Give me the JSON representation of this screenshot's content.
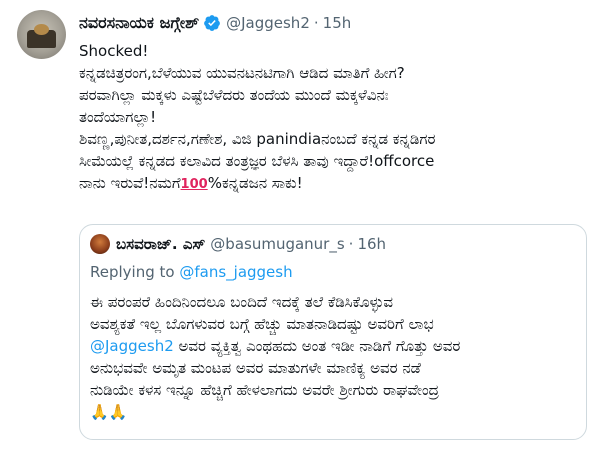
{
  "tweet": {
    "author_name": "ನವರಸನಾಯಕ ಜಗ್ಗೇಶ್",
    "handle": "@Jaggesh2",
    "separator": "·",
    "time": "15h",
    "lines": [
      "Shocked!",
      "ಕನ್ನಡಚಿತ್ರರಂಗ,ಬೆಳೆಯುವ ಯುವನಟನಟಿಗಾಗಿ ಆಡಿದ ಮಾತಿಗೆ ಹೀಗ?",
      "ಪರವಾಗಿಲ್ಲಾ ಮಕ್ಕಳು ಎಷ್ಟೆಬೆಳೆದರು ತಂದೆಯ ಮುಂದೆ ಮಕ್ಕಳೆವಿನಃ",
      "ತಂದೆಯಾಗಲ್ಲಾ!",
      "ಶಿವಣ್ಣ,ಪುನೀತ,ದರ್ಶನ,ಗಣೇಶ, ವಿಜಿ panindiaನಂಬದೆ ಕನ್ನಡ ಕನ್ನಡಿಗರ",
      "ಸೀಮೆಯಲ್ಲೆ ಕನ್ನಡದ ಕಲಾವಿದ ತಂತ್ರಜ್ಞರ ಬೆಳಸಿ ತಾವು ಇದ್ದಾರೆ!offcorce"
    ],
    "last_line_prefix": "ನಾನು ಇರುವೆ!ನಮಗೆ",
    "last_line_emoji": "100",
    "last_line_suffix": "%ಕನ್ನಡಜನ ಸಾಕು!"
  },
  "quote": {
    "author_name": "ಬಸವರಾಜ್. ಎಸ್",
    "handle": "@basumuganur_s",
    "separator": "·",
    "time": "16h",
    "replying_prefix": "Replying to",
    "replying_mention": "@fans_jaggesh",
    "lines": [
      "ಈ ಪರಂಪರೆ ಹಿಂದಿನಿಂದಲೂ ಬಂದಿದೆ ಇದಕ್ಕೆ ತಲೆ ಕೆಡಿಸಿಕೊಳ್ಳುವ",
      "ಅವಶ್ಯಕತೆ ಇಲ್ಲ ಬೊಗಳುವರ ಬಗ್ಗೆ ಹೆಚ್ಚು ಮಾತನಾಡಿದಷ್ಟು ಅವರಿಗೆ ಲಾಭ"
    ],
    "mention_line_mention": "@Jaggesh2",
    "mention_line_rest": " ಅವರ ವ್ಯಕ್ತಿತ್ವ ಎಂಥಹದು ಅಂತ ಇಡೀ ನಾಡಿಗೆ ಗೊತ್ತು ಅವರ",
    "lines_after": [
      "ಅನುಭವವೇ ಅಮೃತ ಮಂಟಪ ಅವರ ಮಾತುಗಳೇ ಮಾಣಿಕ್ಯ ಅವರ ನಡೆ",
      "ನುಡಿಯೇ ಕಳಸ ಇನ್ನೂ ಹೆಚ್ಚಿಗೆ ಹೇಳಲಾಗದು ಅವರೇ ಶ್ರೀಗುರು ರಾಘವೇಂದ್ರ"
    ],
    "hands": "🙏🙏"
  },
  "colors": {
    "verified": "#1d9bf0",
    "muted": "#536471",
    "link": "#1d9bf0",
    "border": "#cfd9de"
  },
  "icons": {
    "verified": "verified-badge-icon",
    "hundred": "hundred-points-emoji",
    "hands": "folded-hands-emoji"
  }
}
